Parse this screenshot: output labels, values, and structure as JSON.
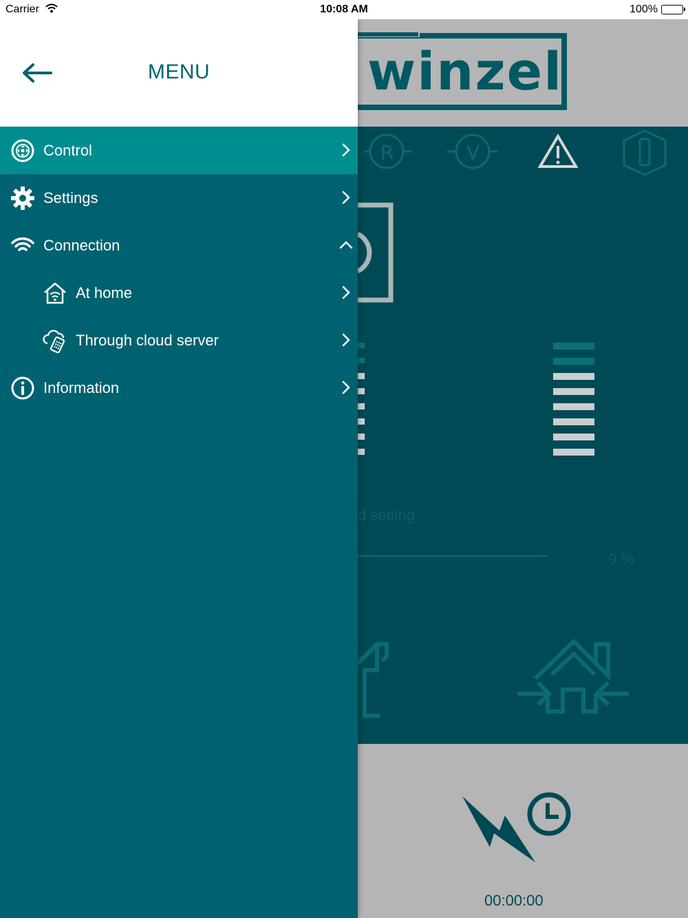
{
  "status_bar": {
    "carrier": "Carrier",
    "time": "10:08 AM",
    "battery": "100%"
  },
  "drawer": {
    "title": "MENU",
    "items": [
      {
        "label": "Control",
        "icon": "control-icon",
        "chevron": "right",
        "active": true
      },
      {
        "label": "Settings",
        "icon": "gear-icon",
        "chevron": "right",
        "active": false
      },
      {
        "label": "Connection",
        "icon": "wifi-icon",
        "chevron": "up",
        "active": false
      },
      {
        "label": "At home",
        "icon": "home-wifi-icon",
        "chevron": "right",
        "sub": true
      },
      {
        "label": "Through cloud server",
        "icon": "cloud-server-icon",
        "chevron": "right",
        "sub": true
      },
      {
        "label": "Information",
        "icon": "info-icon",
        "chevron": "right",
        "active": false
      }
    ]
  },
  "background_app": {
    "logo": "winzel",
    "setting_text_fragment": "d setting",
    "percent": "9 %",
    "timer": "00:00:00"
  },
  "colors": {
    "drawer_bg": "#006270",
    "active_item_bg": "#008d90",
    "main_body_bg": "#004a55",
    "header_gray": "#b5b5b5",
    "title_teal": "#006270"
  }
}
